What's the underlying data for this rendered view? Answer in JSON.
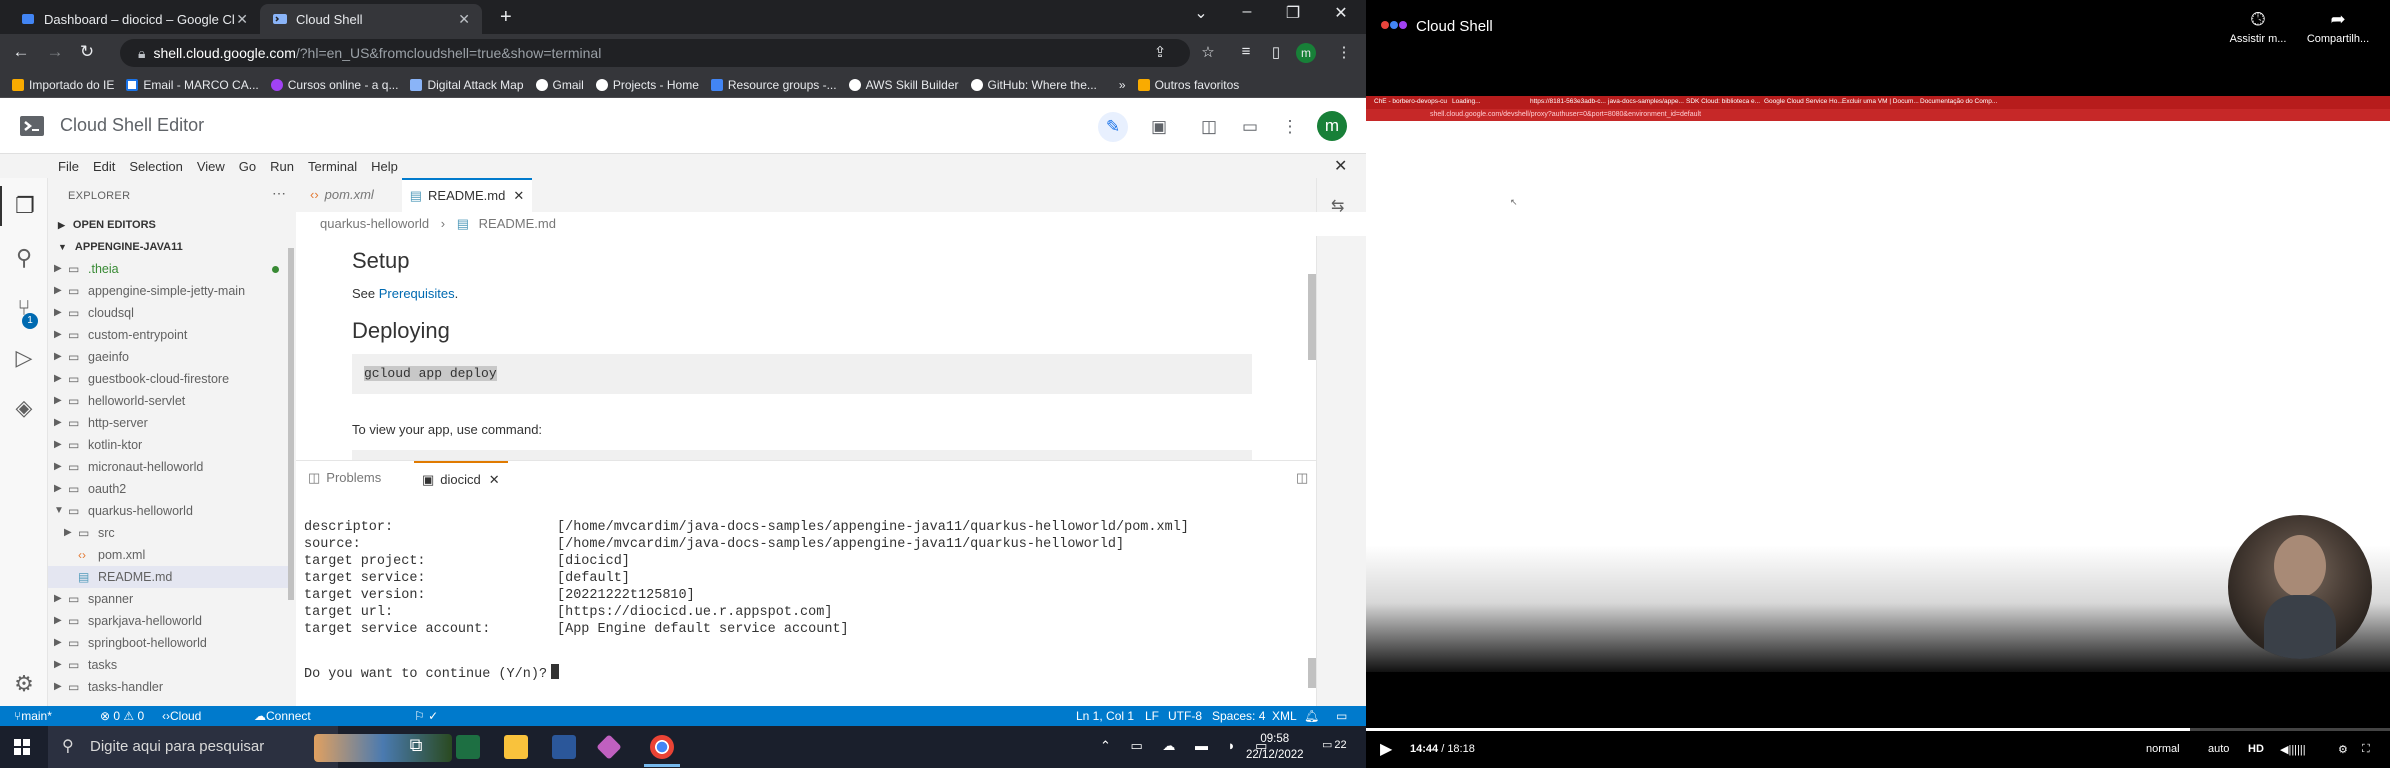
{
  "browser": {
    "tabs": [
      {
        "title": "Dashboard – diocicd – Google Cl",
        "active": false
      },
      {
        "title": "Cloud Shell",
        "active": true
      }
    ],
    "url_host": "shell.cloud.google.com",
    "url_rest": "/?hl=en_US&fromcloudshell=true&show=terminal",
    "profile_initial": "m",
    "bookmarks": [
      "Importado do IE",
      "Email - MARCO CA...",
      "Cursos online - a q...",
      "Digital Attack Map",
      "Gmail",
      "Projects - Home",
      "Resource groups -...",
      "AWS Skill Builder",
      "GitHub: Where the..."
    ],
    "bookmarks_more": "»",
    "bookmarks_other": "Outros favoritos"
  },
  "app": {
    "title": "Cloud Shell Editor",
    "avatar": "m",
    "menu": [
      "File",
      "Edit",
      "Selection",
      "View",
      "Go",
      "Run",
      "Terminal",
      "Help"
    ]
  },
  "explorer": {
    "header": "EXPLORER",
    "open_editors": "OPEN EDITORS",
    "root": "APPENGINE-JAVA11",
    "items": [
      {
        "label": ".theia",
        "type": "folder",
        "modified": true
      },
      {
        "label": "appengine-simple-jetty-main",
        "type": "folder"
      },
      {
        "label": "cloudsql",
        "type": "folder"
      },
      {
        "label": "custom-entrypoint",
        "type": "folder"
      },
      {
        "label": "gaeinfo",
        "type": "folder"
      },
      {
        "label": "guestbook-cloud-firestore",
        "type": "folder"
      },
      {
        "label": "helloworld-servlet",
        "type": "folder"
      },
      {
        "label": "http-server",
        "type": "folder"
      },
      {
        "label": "kotlin-ktor",
        "type": "folder"
      },
      {
        "label": "micronaut-helloworld",
        "type": "folder"
      },
      {
        "label": "oauth2",
        "type": "folder"
      },
      {
        "label": "quarkus-helloworld",
        "type": "folder-open"
      },
      {
        "label": "src",
        "type": "subfolder"
      },
      {
        "label": "pom.xml",
        "type": "file-xml"
      },
      {
        "label": "README.md",
        "type": "file-md",
        "selected": true
      },
      {
        "label": "spanner",
        "type": "folder"
      },
      {
        "label": "sparkjava-helloworld",
        "type": "folder"
      },
      {
        "label": "springboot-helloworld",
        "type": "folder"
      },
      {
        "label": "tasks",
        "type": "folder"
      },
      {
        "label": "tasks-handler",
        "type": "folder"
      }
    ],
    "scm_badge": "1"
  },
  "editor": {
    "tabs": [
      {
        "label": "pom.xml",
        "active": false
      },
      {
        "label": "README.md",
        "active": true
      }
    ],
    "breadcrumb": [
      "quarkus-helloworld",
      "README.md"
    ],
    "preview": {
      "h_setup": "Setup",
      "see": "See",
      "prereq_link": "Prerequisites",
      "period": ".",
      "h_deploy": "Deploying",
      "code_deploy": "gcloud app deploy",
      "view_text": "To view your app, use command:"
    }
  },
  "panel": {
    "tabs": [
      {
        "label": "Problems",
        "active": false
      },
      {
        "label": "diocicd",
        "active": true
      }
    ],
    "lines": [
      {
        "key": "descriptor:",
        "value": "[/home/mvcardim/java-docs-samples/appengine-java11/quarkus-helloworld/pom.xml]"
      },
      {
        "key": "source:",
        "value": "[/home/mvcardim/java-docs-samples/appengine-java11/quarkus-helloworld]"
      },
      {
        "key": "target project:",
        "value": "[diocicd]"
      },
      {
        "key": "target service:",
        "value": "[default]"
      },
      {
        "key": "target version:",
        "value": "[20221222t125810]"
      },
      {
        "key": "target url:",
        "value": "[https://diocicd.ue.r.appspot.com]"
      },
      {
        "key": "target service account:",
        "value": "[App Engine default service account]"
      }
    ],
    "prompt": "Do you want to continue (Y/n)?"
  },
  "statusbar": {
    "branch": "main*",
    "problems": "⊗ 0 ⚠ 0",
    "cloud_code": "Cloud Code",
    "connect": "Connect to Google Cloud",
    "position": "Ln 1, Col 1",
    "eol": "LF",
    "encoding": "UTF-8",
    "spaces": "Spaces: 4",
    "language": "XML"
  },
  "taskbar": {
    "search_placeholder": "Digite aqui para pesquisar",
    "time": "09:58",
    "date": "22/12/2022",
    "notif_count": "22"
  },
  "video": {
    "title": "Cloud Shell",
    "watch_later": "Assistir m...",
    "share": "Compartilh...",
    "time_current": "14:44",
    "time_total": "18:18",
    "time_sep": " / ",
    "progress": 0.805,
    "speed": "normal",
    "quality": "auto",
    "hd": "HD",
    "mini_tabs": [
      "ChE - borbero-devops-cu",
      "Loading...",
      "https://8181-563e3adb-c...",
      "java-docs-samples/appe...",
      "SDK Cloud: biblioteca e...",
      "Google Cloud Service Ho...",
      "Excluir uma VM | Docum...",
      "Documentação do Comp..."
    ],
    "mini_url": "shell.cloud.google.com/devshell/proxy?authuser=0&port=8080&environment_id=default"
  },
  "colors": {
    "statusbar": "#007acc",
    "accent_green": "#188038",
    "link": "#006ab1"
  }
}
